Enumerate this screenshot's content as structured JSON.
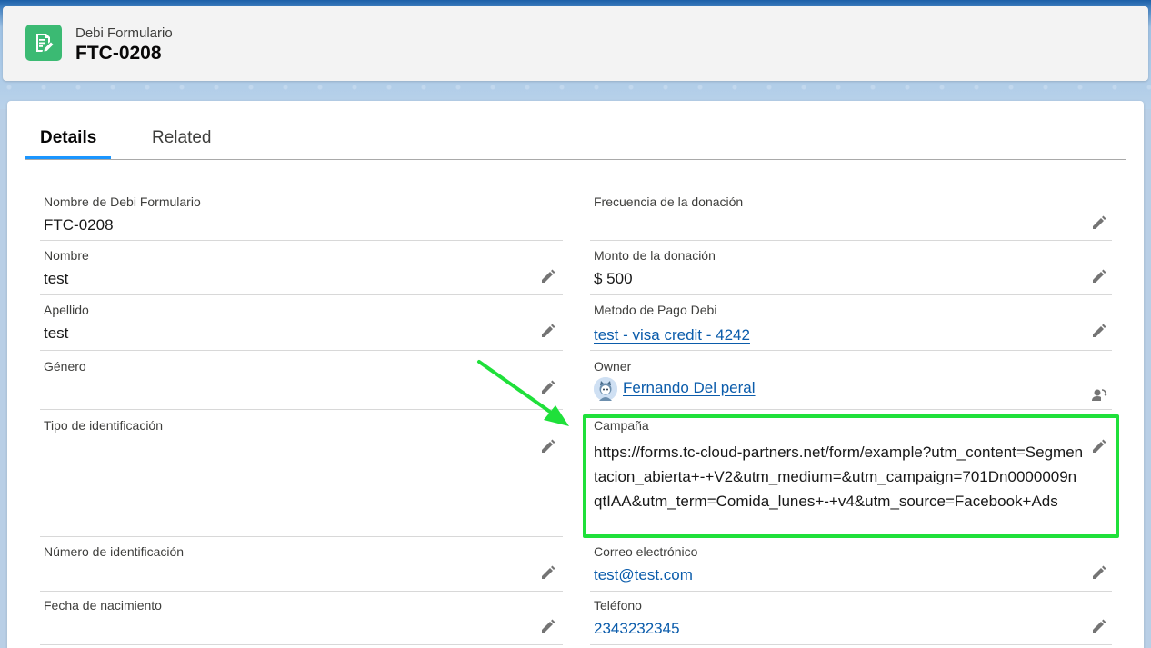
{
  "header": {
    "object_label": "Debi Formulario",
    "record_title": "FTC-0208",
    "icon": "form-record-icon"
  },
  "tabs": [
    {
      "label": "Details",
      "active": true
    },
    {
      "label": "Related",
      "active": false
    }
  ],
  "left_fields": [
    {
      "label": "Nombre de Debi Formulario",
      "value": "FTC-0208",
      "editable": false
    },
    {
      "label": "Nombre",
      "value": "test",
      "editable": true
    },
    {
      "label": "Apellido",
      "value": "test",
      "editable": true
    },
    {
      "label": "Género",
      "value": "",
      "editable": true
    },
    {
      "label": "Tipo de identificación",
      "value": "",
      "editable": true
    },
    {
      "label": "Número de identificación",
      "value": "",
      "editable": true
    },
    {
      "label": "Fecha de nacimiento",
      "value": "",
      "editable": true
    }
  ],
  "right_fields": {
    "frecuencia": {
      "label": "Frecuencia de la donación",
      "value": ""
    },
    "monto": {
      "label": "Monto de la donación",
      "value": "$ 500"
    },
    "metodo": {
      "label": "Metodo de Pago Debi",
      "value": "test - visa credit - 4242"
    },
    "owner": {
      "label": "Owner",
      "value": "Fernando Del peral"
    },
    "campana": {
      "label": "Campaña",
      "value": "https://forms.tc-cloud-partners.net/form/example?utm_content=Segmentacion_abierta+-+V2&utm_medium=&utm_campaign=701Dn0000009nqtIAA&utm_term=Comida_lunes+-+v4&utm_source=Facebook+Ads"
    },
    "correo": {
      "label": "Correo electrónico",
      "value": "test@test.com"
    },
    "telefono": {
      "label": "Teléfono",
      "value": "2343232345"
    }
  },
  "colors": {
    "accent": "#1b96ff",
    "link": "#0b5cab",
    "icon_bg": "#3bba73",
    "annotation": "#1fe03a"
  }
}
